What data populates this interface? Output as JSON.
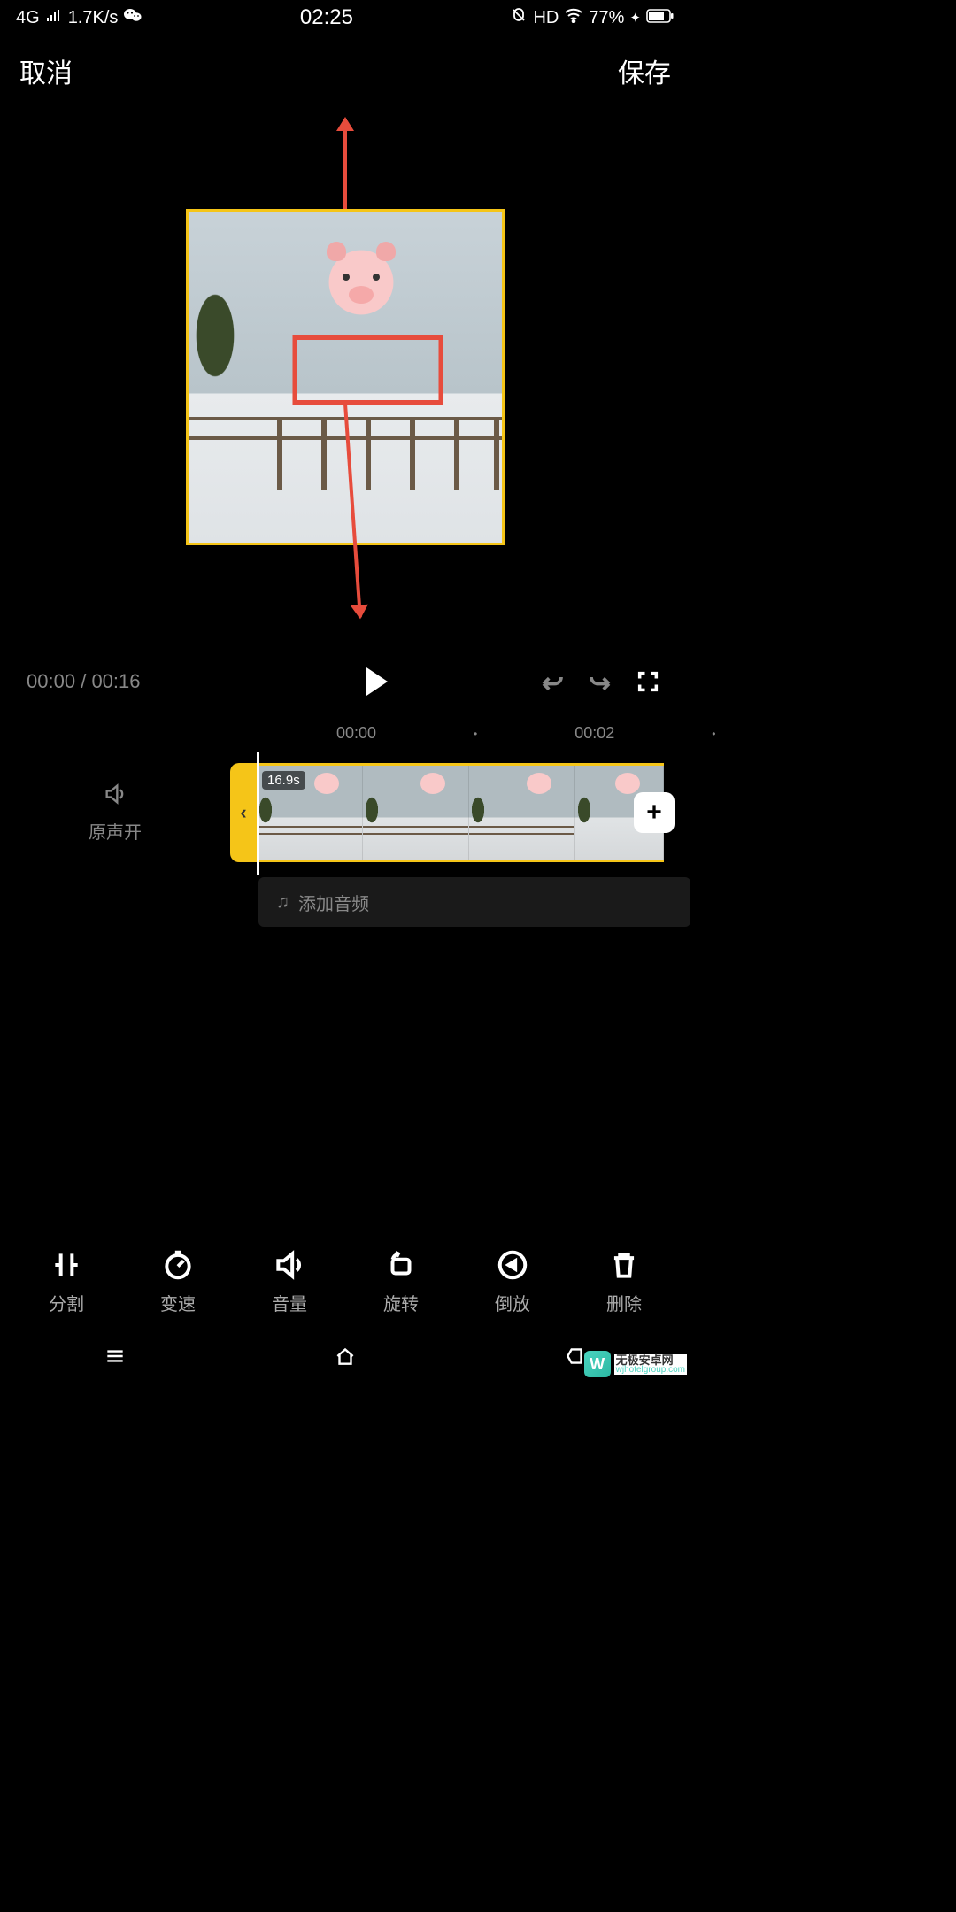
{
  "status": {
    "network": "4G",
    "speed": "1.7K/s",
    "time": "02:25",
    "hd": "HD",
    "battery": "77%"
  },
  "header": {
    "cancel": "取消",
    "save": "保存"
  },
  "playback": {
    "current": "00:00",
    "sep": "/",
    "total": "00:16"
  },
  "ruler": {
    "t0": "00:00",
    "t1": "00:02"
  },
  "timeline": {
    "sound_label": "原声开",
    "clip_duration": "16.9s",
    "add_audio": "添加音频"
  },
  "toolbar": {
    "split": "分割",
    "speed": "变速",
    "volume": "音量",
    "rotate": "旋转",
    "reverse": "倒放",
    "delete": "删除"
  },
  "watermark": {
    "cn": "无极安卓网",
    "en": "wjhotelgroup.com"
  }
}
